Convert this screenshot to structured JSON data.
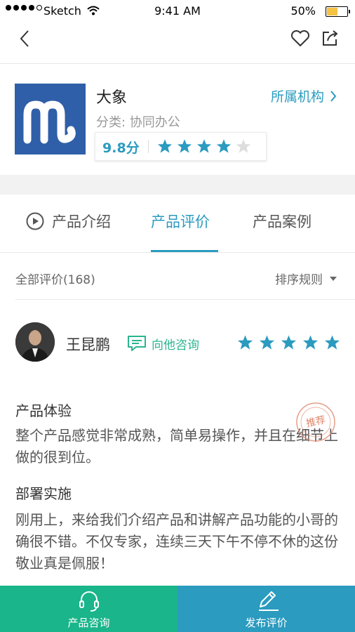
{
  "status": {
    "carrier": "Sketch",
    "time": "9:41 AM",
    "battery": "50%",
    "battery_level": 0.5
  },
  "app": {
    "name": "大象",
    "category_label": "分类: ",
    "category": "协同办公",
    "org_link": "所属机构",
    "score": "9.8分",
    "rating": 4
  },
  "tabs": [
    {
      "label": "产品介绍",
      "active": false
    },
    {
      "label": "产品评价",
      "active": true
    },
    {
      "label": "产品案例",
      "active": false
    }
  ],
  "reviews_header": {
    "total": "全部评价(168)",
    "sort": "排序规则"
  },
  "review": {
    "name": "王昆鹏",
    "consult": "向他咨询",
    "rating": 5,
    "stamp_text": "推荐",
    "sections": [
      {
        "title": "产品体验",
        "text": "整个产品感觉非常成熟，简单易操作，并且在细节上做的很到位。"
      },
      {
        "title": "部署实施",
        "text": "刚用上，来给我们介绍产品和讲解产品功能的小哥的确很不错。不仅专家，连续三天下午不停不休的这份敬业真是佩服！"
      }
    ]
  },
  "bottom": {
    "left_label": "产品咨询",
    "right_label": "发布评价"
  },
  "colors": {
    "accent": "#2b9bbf",
    "green": "#1ab58a",
    "star_off": "#dddddd",
    "logo_bg": "#2f5fa8"
  }
}
